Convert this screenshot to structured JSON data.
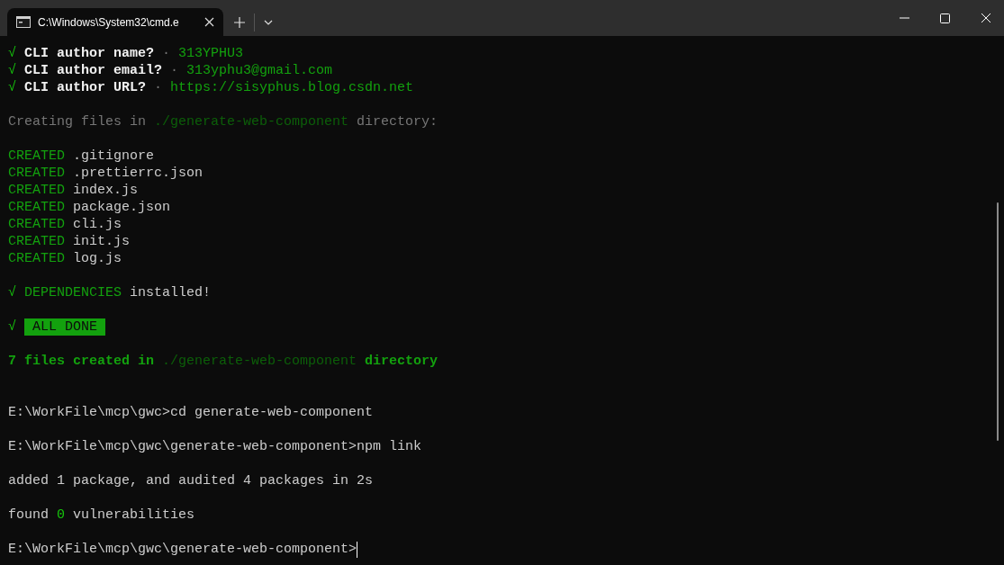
{
  "window": {
    "tab_title": "C:\\Windows\\System32\\cmd.e"
  },
  "terminal": {
    "lines": [
      {
        "kind": "text",
        "segments": [
          {
            "text": "√",
            "kind": "check"
          },
          {
            "text": " CLI author name? ",
            "kind": "bold"
          },
          {
            "text": "·",
            "kind": "dim"
          },
          {
            "text": " 313YPHU3",
            "kind": "green"
          }
        ]
      },
      {
        "kind": "text",
        "segments": [
          {
            "text": "√",
            "kind": "check"
          },
          {
            "text": " CLI author email? ",
            "kind": "bold"
          },
          {
            "text": "·",
            "kind": "dim"
          },
          {
            "text": " 313yphu3@gmail.com",
            "kind": "green"
          }
        ]
      },
      {
        "kind": "text",
        "segments": [
          {
            "text": "√",
            "kind": "check"
          },
          {
            "text": " CLI author URL? ",
            "kind": "bold"
          },
          {
            "text": "·",
            "kind": "dim"
          },
          {
            "text": " https://sisyphus.blog.csdn.net",
            "kind": "green"
          }
        ]
      },
      {
        "kind": "blank"
      },
      {
        "kind": "text",
        "segments": [
          {
            "text": "Creating files in ",
            "kind": "dim"
          },
          {
            "text": "./generate-web-component",
            "kind": "darkgreen"
          },
          {
            "text": " directory:",
            "kind": "dim"
          }
        ]
      },
      {
        "kind": "blank"
      },
      {
        "kind": "text",
        "segments": [
          {
            "text": "CREATED",
            "kind": "green"
          },
          {
            "text": " .gitignore",
            "kind": "plain"
          }
        ]
      },
      {
        "kind": "text",
        "segments": [
          {
            "text": "CREATED",
            "kind": "green"
          },
          {
            "text": " .prettierrc.json",
            "kind": "plain"
          }
        ]
      },
      {
        "kind": "text",
        "segments": [
          {
            "text": "CREATED",
            "kind": "green"
          },
          {
            "text": " index.js",
            "kind": "plain"
          }
        ]
      },
      {
        "kind": "text",
        "segments": [
          {
            "text": "CREATED",
            "kind": "green"
          },
          {
            "text": " package.json",
            "kind": "plain"
          }
        ]
      },
      {
        "kind": "text",
        "segments": [
          {
            "text": "CREATED",
            "kind": "green"
          },
          {
            "text": " cli.js",
            "kind": "plain"
          }
        ]
      },
      {
        "kind": "text",
        "segments": [
          {
            "text": "CREATED",
            "kind": "green"
          },
          {
            "text": " init.js",
            "kind": "plain"
          }
        ]
      },
      {
        "kind": "text",
        "segments": [
          {
            "text": "CREATED",
            "kind": "green"
          },
          {
            "text": " log.js",
            "kind": "plain"
          }
        ]
      },
      {
        "kind": "blank"
      },
      {
        "kind": "text",
        "segments": [
          {
            "text": "√",
            "kind": "check"
          },
          {
            "text": " DEPENDENCIES",
            "kind": "green"
          },
          {
            "text": " installed!",
            "kind": "plain"
          }
        ]
      },
      {
        "kind": "blank"
      },
      {
        "kind": "text",
        "segments": [
          {
            "text": "√ ",
            "kind": "check"
          },
          {
            "text": " ALL DONE ",
            "kind": "badge"
          }
        ]
      },
      {
        "kind": "blank"
      },
      {
        "kind": "text",
        "segments": [
          {
            "text": "7 files created in ",
            "kind": "greenbold"
          },
          {
            "text": "./generate-web-component",
            "kind": "darkgreen"
          },
          {
            "text": " directory",
            "kind": "greenbold"
          }
        ]
      },
      {
        "kind": "blank"
      },
      {
        "kind": "blank"
      },
      {
        "kind": "text",
        "segments": [
          {
            "text": "E:\\WorkFile\\mcp\\gwc>cd generate-web-component",
            "kind": "plain"
          }
        ]
      },
      {
        "kind": "blank"
      },
      {
        "kind": "text",
        "segments": [
          {
            "text": "E:\\WorkFile\\mcp\\gwc\\generate-web-component>npm link",
            "kind": "plain"
          }
        ]
      },
      {
        "kind": "blank"
      },
      {
        "kind": "text",
        "segments": [
          {
            "text": "added 1 package, and audited 4 packages in 2s",
            "kind": "plain"
          }
        ]
      },
      {
        "kind": "blank"
      },
      {
        "kind": "text",
        "segments": [
          {
            "text": "found ",
            "kind": "plain"
          },
          {
            "text": "0",
            "kind": "brightgreen"
          },
          {
            "text": " vulnerabilities",
            "kind": "plain"
          }
        ]
      },
      {
        "kind": "blank"
      },
      {
        "kind": "prompt",
        "segments": [
          {
            "text": "E:\\WorkFile\\mcp\\gwc\\generate-web-component>",
            "kind": "plain"
          }
        ]
      }
    ]
  }
}
